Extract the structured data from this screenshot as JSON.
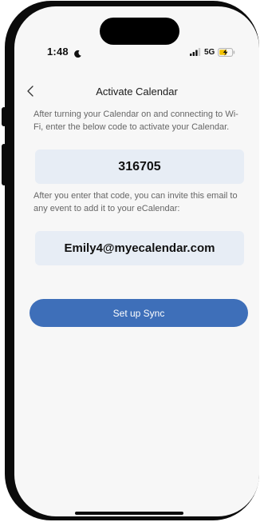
{
  "status_bar": {
    "time": "1:48",
    "network": "5G",
    "icons": [
      "moon-icon",
      "signal-icon",
      "battery-charging-icon"
    ]
  },
  "nav": {
    "back_icon": "chevron-left-icon",
    "title": "Activate Calendar"
  },
  "instructions": {
    "activate_text": "After turning your Calendar on and connecting to Wi-Fi, enter the below code to activate your Calendar.",
    "code": "316705",
    "invite_text": "After you enter that code, you can invite this email to any event to add it to your eCalendar:",
    "email": "Emily4@myecalendar.com"
  },
  "actions": {
    "sync_label": "Set up Sync"
  },
  "colors": {
    "accent": "#3e6fb9",
    "field_bg": "#e7edf5",
    "screen_bg": "#f7f7f7",
    "battery_charging": "#f2c200"
  }
}
